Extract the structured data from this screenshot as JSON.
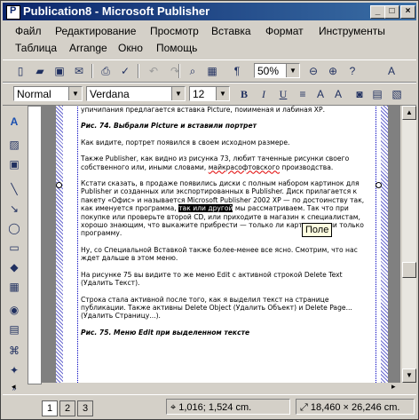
{
  "window": {
    "title": "Publication8 - Microsoft Publisher"
  },
  "menu": [
    "Файл",
    "Редактирование",
    "Просмотр",
    "Вставка",
    "Формат",
    "Инструменты",
    "Таблица",
    "Arrange",
    "Окно",
    "Помощь"
  ],
  "toolbar": {
    "zoom": "50%"
  },
  "format": {
    "style": "Normal",
    "font": "Verdana",
    "size": "12"
  },
  "document": {
    "p0": "упичипания предлагается вставка Picture, поиименая и лабиная ХР.",
    "caption1": "Рис. 74. Выбрали Picture и вставили портрет",
    "p1": "Как видите, портрет появился в своем исходном размере.",
    "p2a": "Также Publisher, как видно из рисунка 73, любит таченные рисунки своего собственного или, иными словами, ",
    "p2b": "майкрасофтовского",
    "p2c": " производства.",
    "p3a": "Кстати сказать, в продаже появились диски с полным набором картинок для Publisher и созданных или экспортированных в Publisher. Диск прилагается к пакету «Офис» и называется Microsoft Publisher 2002 XP — по достоинству так, как именуется программа, ",
    "p3sel": "так или другой",
    "p3b": " мы рассматриваем. Так что при покупке или проверьте второй CD, или приходите в магазин к специалистам, хорошо знающим, что выкажите прибрести — только ли картинки, или только программу.",
    "p4": "Ну, со Специальной Вставкой также более-менее все ясно. Смотрим, что нас ждет дальше в этом меню.",
    "p5": "На рисунке 75 вы видите то же меню Edit с активной строкой Delete Text (Удалить Текст).",
    "p6": "Строка стала активной после того, как я выделил текст на странице публикации. Также активны Delete Object (Удалить Объект) и Delete Page... (Удалить Страницу...).",
    "caption2": "Рис. 75. Меню Edit при выделенном тексте"
  },
  "tooltip": "Поле",
  "status": {
    "pages": [
      "1",
      "2",
      "3"
    ],
    "position": "1,016; 1,524 cm.",
    "size": "18,460 × 26,246 cm."
  }
}
